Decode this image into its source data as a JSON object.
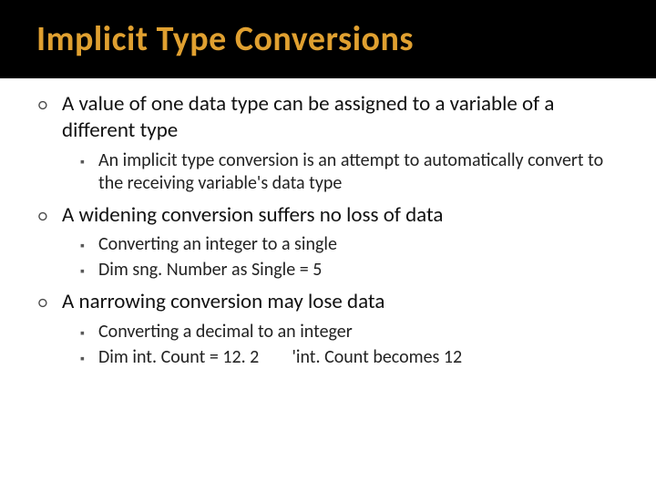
{
  "slide": {
    "title": "Implicit Type Conversions",
    "points": [
      {
        "text": "A value of one data type can be assigned to a variable of a different type",
        "sub": [
          "An implicit type conversion is an attempt to automatically convert to the receiving variable's data type"
        ]
      },
      {
        "text": "A widening conversion suffers no loss of data",
        "sub": [
          "Converting an integer to a single",
          "Dim sng. Number as Single = 5"
        ]
      },
      {
        "text": "A narrowing conversion may lose data",
        "sub": [
          "Converting a decimal to an integer",
          "Dim int. Count = 12. 2        'int. Count becomes 12"
        ]
      }
    ]
  }
}
